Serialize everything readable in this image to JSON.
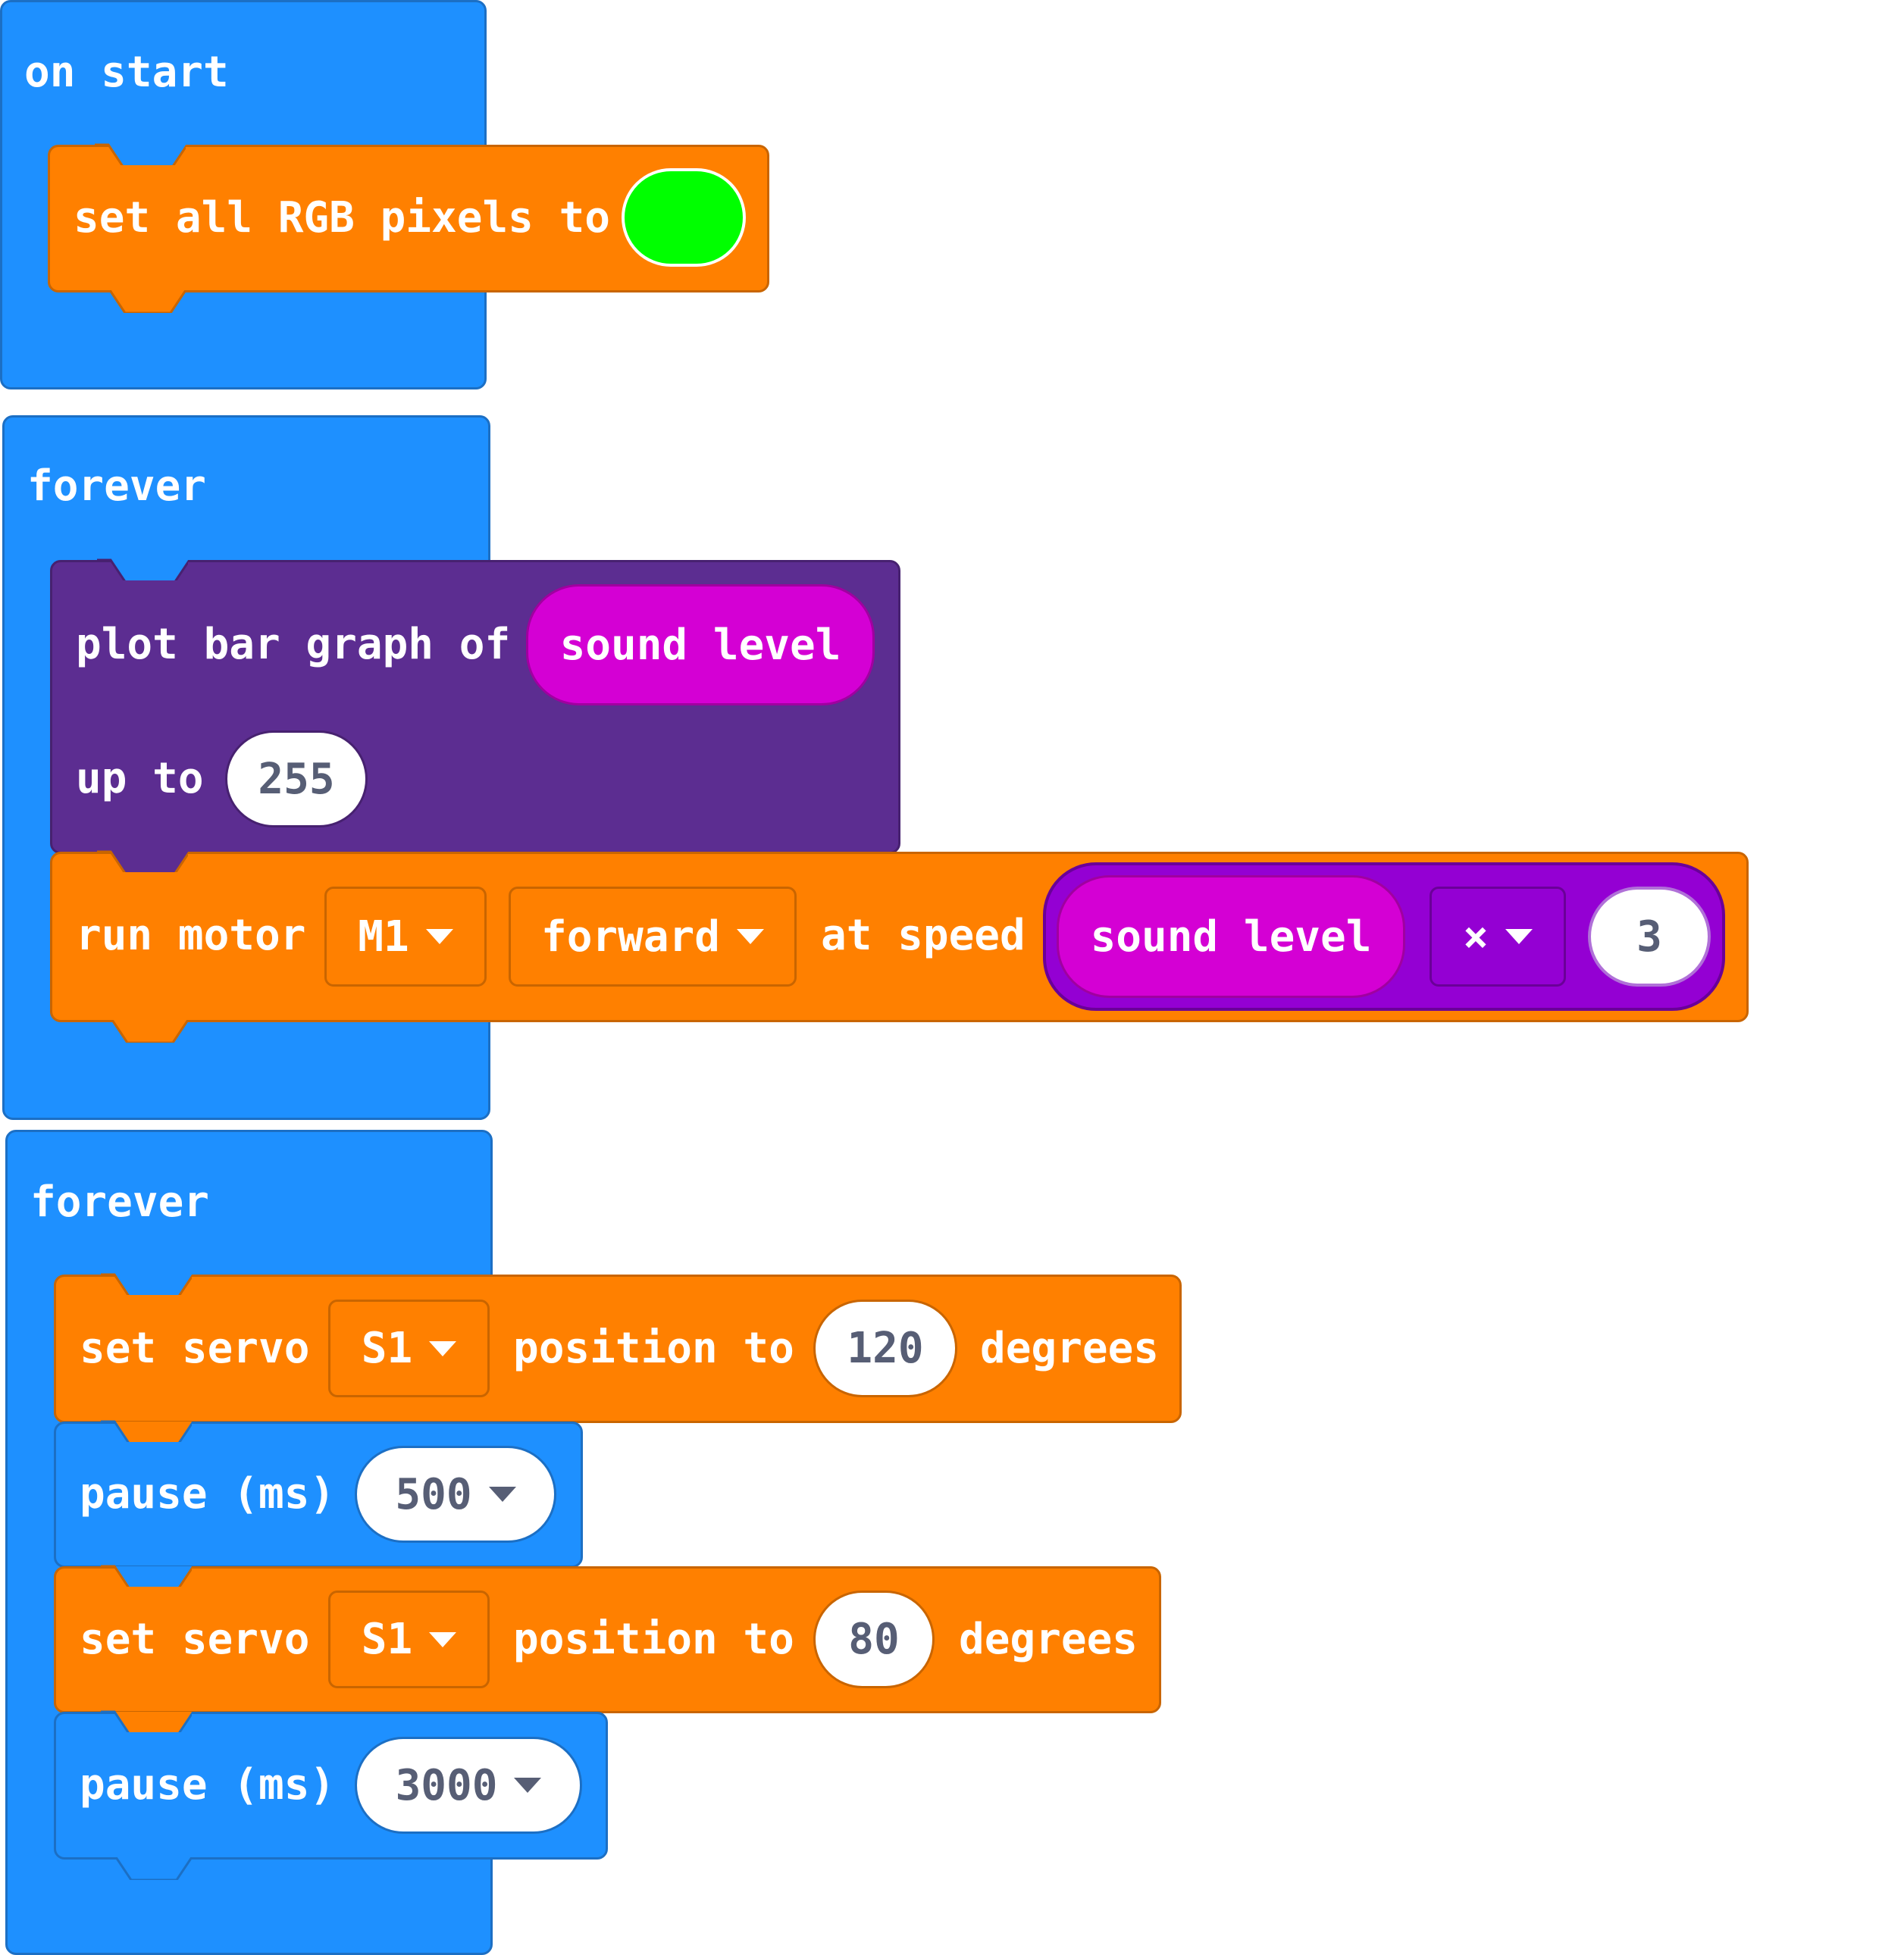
{
  "colors": {
    "event_blue": "#1e90ff",
    "motor_orange": "#ff8000",
    "led_purple": "#5c2d91",
    "input_magenta": "#d400d4",
    "math_purple": "#9400d3",
    "color_green": "#00ff00"
  },
  "blocks": {
    "on_start": {
      "label": "on start",
      "set_rgb": {
        "label": "set all RGB pixels to",
        "color_value": "#00ff00"
      }
    },
    "forever1": {
      "label": "forever",
      "plot": {
        "label": "plot bar graph of",
        "value_label": "sound level",
        "up_to_label": "up to",
        "up_to_value": "255"
      },
      "motor": {
        "label": "run motor",
        "motor_select": "M1",
        "direction_select": "forward",
        "speed_label": "at speed",
        "expr": {
          "left": "sound level",
          "operator": "×",
          "right": "3"
        }
      }
    },
    "forever2": {
      "label": "forever",
      "servo1": {
        "label": "set servo",
        "servo_select": "S1",
        "position_label": "position to",
        "value": "120",
        "unit": "degrees"
      },
      "pause1": {
        "label": "pause (ms)",
        "value": "500"
      },
      "servo2": {
        "label": "set servo",
        "servo_select": "S1",
        "position_label": "position to",
        "value": "80",
        "unit": "degrees"
      },
      "pause2": {
        "label": "pause (ms)",
        "value": "3000"
      }
    }
  }
}
